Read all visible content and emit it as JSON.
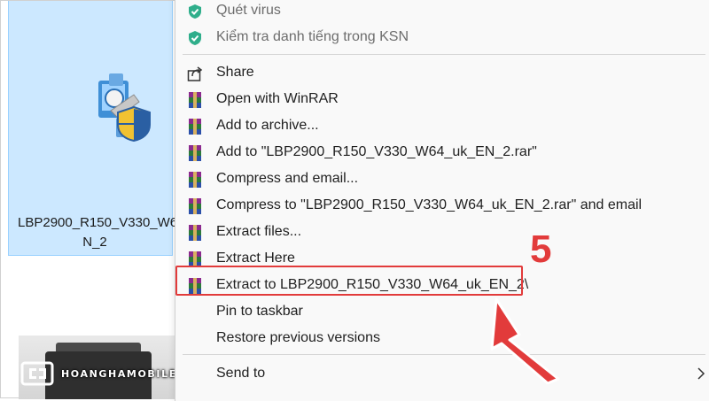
{
  "file": {
    "name_line1": "LBP2900_R150_V330_W6",
    "name_line2": "N_2"
  },
  "context_menu": {
    "items": [
      {
        "label": "Quét virus",
        "icon": "shield-check-icon",
        "style": "grey"
      },
      {
        "label": "Kiểm tra danh tiếng trong KSN",
        "icon": "shield-check-icon",
        "style": "grey"
      },
      {
        "label": "Share",
        "icon": "share-icon",
        "style": "normal"
      },
      {
        "label": "Open with WinRAR",
        "icon": "winrar-icon",
        "style": "normal"
      },
      {
        "label": "Add to archive...",
        "icon": "winrar-icon",
        "style": "normal"
      },
      {
        "label": "Add to \"LBP2900_R150_V330_W64_uk_EN_2.rar\"",
        "icon": "winrar-icon",
        "style": "normal"
      },
      {
        "label": "Compress and email...",
        "icon": "winrar-icon",
        "style": "normal"
      },
      {
        "label": "Compress to \"LBP2900_R150_V330_W64_uk_EN_2.rar\" and email",
        "icon": "winrar-icon",
        "style": "normal"
      },
      {
        "label": "Extract files...",
        "icon": "winrar-icon",
        "style": "normal"
      },
      {
        "label": "Extract Here",
        "icon": "winrar-icon",
        "style": "normal"
      },
      {
        "label": "Extract to LBP2900_R150_V330_W64_uk_EN_2\\",
        "icon": "winrar-icon",
        "style": "normal"
      },
      {
        "label": "Pin to taskbar",
        "icon": "",
        "style": "normal"
      },
      {
        "label": "Restore previous versions",
        "icon": "",
        "style": "normal"
      },
      {
        "label": "Send to",
        "icon": "",
        "style": "normal"
      }
    ]
  },
  "annotation": {
    "step_number": "5",
    "accent_color": "#e23b3b"
  },
  "watermark": {
    "brand": "HOANGHAMOBILE.COM"
  }
}
